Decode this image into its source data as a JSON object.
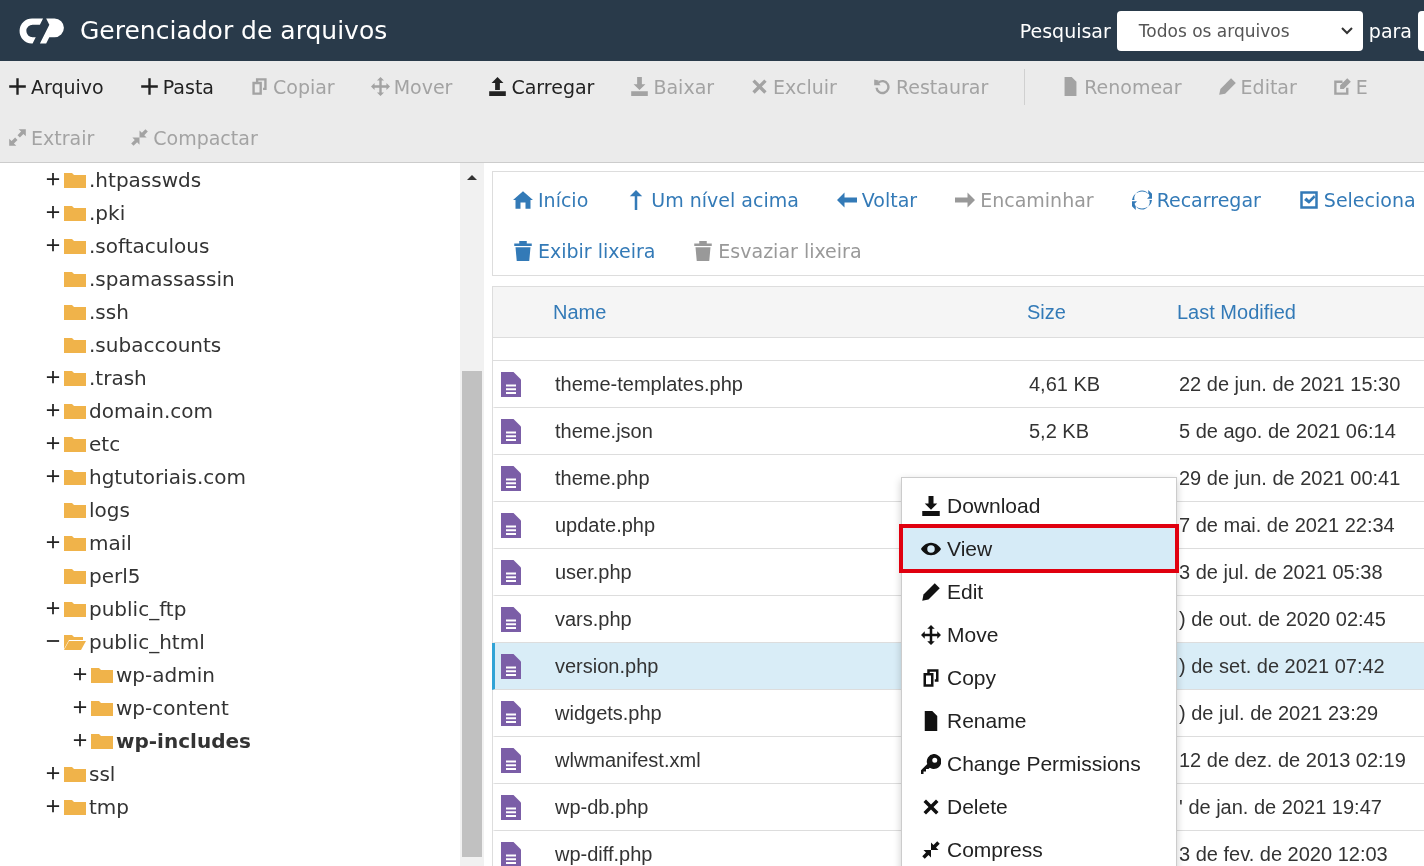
{
  "header": {
    "title": "Gerenciador de arquivos",
    "search_label": "Pesquisar",
    "search_scope": "Todos os arquivos",
    "for_label": "para"
  },
  "toolbar": {
    "rows": [
      [
        {
          "label": "Arquivo",
          "disabled": false
        },
        {
          "label": "Pasta",
          "disabled": false
        },
        {
          "label": "Copiar",
          "disabled": true
        },
        {
          "label": "Mover",
          "disabled": true
        },
        {
          "label": "Carregar",
          "disabled": false
        },
        {
          "label": "Baixar",
          "disabled": true
        },
        {
          "label": "Excluir",
          "disabled": true
        },
        {
          "label": "Restaurar",
          "disabled": true
        },
        {
          "label": "Renomear",
          "disabled": true,
          "divider_before": true
        },
        {
          "label": "Editar",
          "disabled": true
        },
        {
          "label": "E",
          "disabled": true
        }
      ],
      [
        {
          "label": "Extrair",
          "disabled": true
        },
        {
          "label": "Compactar",
          "disabled": true
        }
      ]
    ]
  },
  "tree": [
    {
      "name": ".htpasswds",
      "expandable": true,
      "expanded": false,
      "selected": false
    },
    {
      "name": ".pki",
      "expandable": true,
      "expanded": false,
      "selected": false
    },
    {
      "name": ".softaculous",
      "expandable": true,
      "expanded": false,
      "selected": false
    },
    {
      "name": ".spamassassin",
      "expandable": false,
      "expanded": false,
      "selected": false
    },
    {
      "name": ".ssh",
      "expandable": false,
      "expanded": false,
      "selected": false
    },
    {
      "name": ".subaccounts",
      "expandable": false,
      "expanded": false,
      "selected": false
    },
    {
      "name": ".trash",
      "expandable": true,
      "expanded": false,
      "selected": false
    },
    {
      "name": "domain.com",
      "expandable": true,
      "expanded": false,
      "selected": false
    },
    {
      "name": "etc",
      "expandable": true,
      "expanded": false,
      "selected": false
    },
    {
      "name": "hgtutoriais.com",
      "expandable": true,
      "expanded": false,
      "selected": false
    },
    {
      "name": "logs",
      "expandable": false,
      "expanded": false,
      "selected": false
    },
    {
      "name": "mail",
      "expandable": true,
      "expanded": false,
      "selected": false
    },
    {
      "name": "perl5",
      "expandable": false,
      "expanded": false,
      "selected": false
    },
    {
      "name": "public_ftp",
      "expandable": true,
      "expanded": false,
      "selected": false
    },
    {
      "name": "public_html",
      "expandable": true,
      "expanded": true,
      "selected": false,
      "children": [
        {
          "name": "wp-admin",
          "expandable": true,
          "expanded": false,
          "selected": false
        },
        {
          "name": "wp-content",
          "expandable": true,
          "expanded": false,
          "selected": false
        },
        {
          "name": "wp-includes",
          "expandable": true,
          "expanded": false,
          "selected": true
        }
      ]
    },
    {
      "name": "ssl",
      "expandable": true,
      "expanded": false,
      "selected": false
    },
    {
      "name": "tmp",
      "expandable": true,
      "expanded": false,
      "selected": false
    }
  ],
  "nav": [
    [
      {
        "label": "Início",
        "disabled": false
      },
      {
        "label": "Um nível acima",
        "disabled": false
      },
      {
        "label": "Voltar",
        "disabled": false
      },
      {
        "label": "Encaminhar",
        "disabled": true
      },
      {
        "label": "Recarregar",
        "disabled": false
      },
      {
        "label": "Seleciona",
        "disabled": false
      }
    ],
    [
      {
        "label": "Exibir lixeira",
        "disabled": false
      },
      {
        "label": "Esvaziar lixeira",
        "disabled": true
      }
    ]
  ],
  "table": {
    "columns": [
      "Name",
      "Size",
      "Last Modified"
    ],
    "rows": [
      {
        "name": "theme-templates.php",
        "size": "4,61 KB",
        "modified": "22 de jun. de 2021 15:30",
        "selected": false
      },
      {
        "name": "theme.json",
        "size": "5,2 KB",
        "modified": "5 de ago. de 2021 06:14",
        "selected": false
      },
      {
        "name": "theme.php",
        "modified": "29 de jun. de 2021 00:41",
        "selected": false
      },
      {
        "name": "update.php",
        "modified": "7 de mai. de 2021 22:34",
        "selected": false
      },
      {
        "name": "user.php",
        "modified": "3 de jul. de 2021 05:38",
        "selected": false
      },
      {
        "name": "vars.php",
        "modified": ") de out. de 2020 02:45",
        "selected": false
      },
      {
        "name": "version.php",
        "modified": ") de set. de 2021 07:42",
        "selected": true
      },
      {
        "name": "widgets.php",
        "modified": ") de jul. de 2021 23:29",
        "selected": false
      },
      {
        "name": "wlwmanifest.xml",
        "modified": "12 de dez. de 2013 02:19",
        "selected": false
      },
      {
        "name": "wp-db.php",
        "modified": "' de jan. de 2021 19:47",
        "selected": false
      },
      {
        "name": "wp-diff.php",
        "modified": "3 de fev. de 2020 12:03",
        "selected": false
      }
    ]
  },
  "context_menu": [
    {
      "label": "Download",
      "selected": false
    },
    {
      "label": "View",
      "selected": true
    },
    {
      "label": "Edit",
      "selected": false
    },
    {
      "label": "Move",
      "selected": false
    },
    {
      "label": "Copy",
      "selected": false
    },
    {
      "label": "Rename",
      "selected": false
    },
    {
      "label": "Change Permissions",
      "selected": false
    },
    {
      "label": "Delete",
      "selected": false
    },
    {
      "label": "Compress",
      "selected": false
    }
  ]
}
